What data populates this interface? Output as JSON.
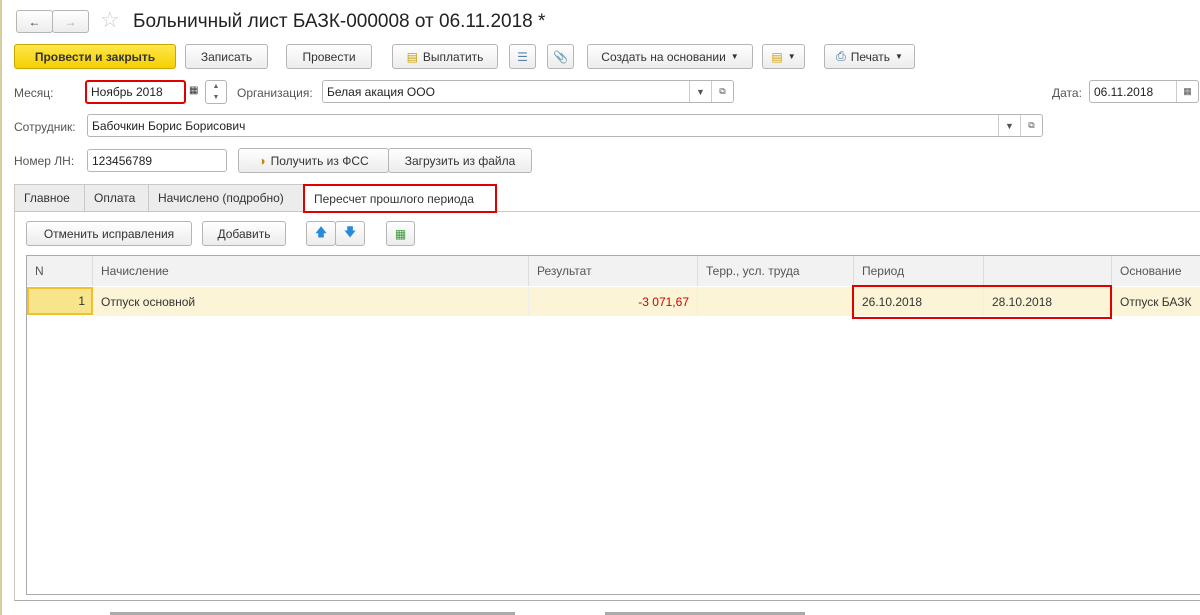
{
  "title": "Больничный лист БАЗК-000008 от 06.11.2018 *",
  "toolbar": {
    "post_close": "Провести и закрыть",
    "save": "Записать",
    "post": "Провести",
    "pay": "Выплатить",
    "create_based": "Создать на основании",
    "print": "Печать"
  },
  "fields": {
    "month_label": "Месяц:",
    "month": "Ноябрь 2018",
    "org_label": "Организация:",
    "org": "Белая акация ООО",
    "date_label": "Дата:",
    "date": "06.11.2018",
    "employee_label": "Сотрудник:",
    "employee": "Бабочкин Борис Борисович",
    "ln_label": "Номер ЛН:",
    "ln": "123456789",
    "get_fss": "Получить из ФСС",
    "load_file": "Загрузить из файла"
  },
  "tabs": [
    "Главное",
    "Оплата",
    "Начислено (подробно)",
    "Пересчет прошлого периода"
  ],
  "table_toolbar": {
    "cancel": "Отменить исправления",
    "add": "Добавить"
  },
  "table": {
    "headers": [
      "N",
      "Начисление",
      "Результат",
      "Терр., усл. труда",
      "Период",
      "",
      "Основание"
    ],
    "rows": [
      {
        "n": "1",
        "accrual": "Отпуск основной",
        "result": "-3 071,67",
        "terr": "",
        "from": "26.10.2018",
        "to": "28.10.2018",
        "basis": "Отпуск БАЗК"
      }
    ]
  }
}
